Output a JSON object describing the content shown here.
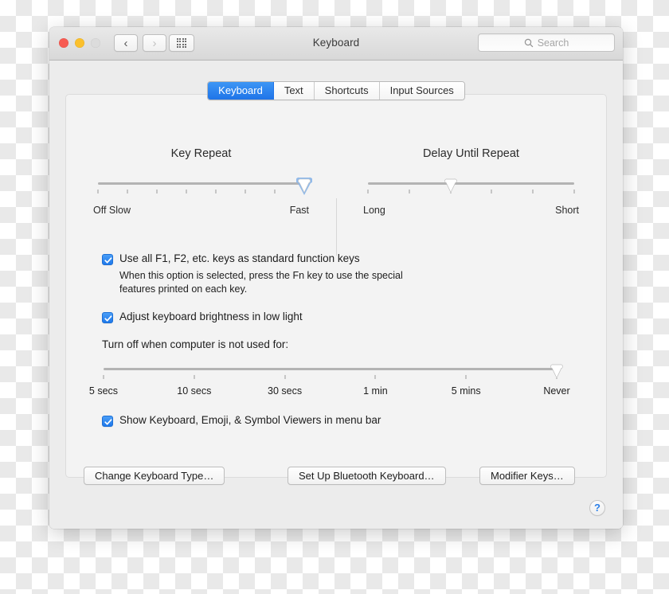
{
  "window": {
    "title": "Keyboard",
    "traffic_lights": [
      {
        "name": "close",
        "color": "#f75b52"
      },
      {
        "name": "minimize",
        "color": "#fbc02c"
      },
      {
        "name": "zoom",
        "color": "#dcdcdc"
      }
    ],
    "nav": {
      "back": "‹",
      "forward": "›"
    },
    "grid_button": "show-all-icon",
    "search": {
      "placeholder": "Search",
      "value": "",
      "icon": "search-icon"
    }
  },
  "tabs": [
    {
      "label": "Keyboard",
      "active": true
    },
    {
      "label": "Text",
      "active": false
    },
    {
      "label": "Shortcuts",
      "active": false
    },
    {
      "label": "Input Sources",
      "active": false
    }
  ],
  "sliders": {
    "key_repeat": {
      "title": "Key Repeat",
      "left_label": "Off Slow",
      "right_label": "Fast",
      "ticks": 8,
      "value": 7,
      "max": 7,
      "focused": true,
      "accent": "#6fa8e8"
    },
    "delay_until_repeat": {
      "title": "Delay Until Repeat",
      "left_label": "Long",
      "right_label": "Short",
      "ticks": 6,
      "value": 2,
      "max": 5,
      "focused": false
    }
  },
  "options": {
    "function_keys": {
      "label": "Use all F1, F2, etc. keys as standard function keys",
      "checked": true,
      "help": "When this option is selected, press the Fn key to use the special features printed on each key."
    },
    "brightness": {
      "label": "Adjust keyboard brightness in low light",
      "checked": true
    },
    "turn_off_label": "Turn off when computer is not used for:",
    "turn_off_slider": {
      "labels": [
        "5 secs",
        "10 secs",
        "30 secs",
        "1 min",
        "5 mins",
        "Never"
      ],
      "value": 5,
      "max": 5
    },
    "viewers": {
      "label": "Show Keyboard, Emoji, & Symbol Viewers in menu bar",
      "checked": true
    }
  },
  "buttons": {
    "change_keyboard_type": "Change Keyboard Type…",
    "set_up_bluetooth": "Set Up Bluetooth Keyboard…",
    "modifier_keys": "Modifier Keys…",
    "help": "?"
  },
  "colors": {
    "accent_blue": "#2a7fe8",
    "tab_active": "#1f74e8",
    "checkbox_blue": "#1e78ea",
    "window_bg": "#ececec",
    "panel_bg": "#f3f3f3"
  }
}
